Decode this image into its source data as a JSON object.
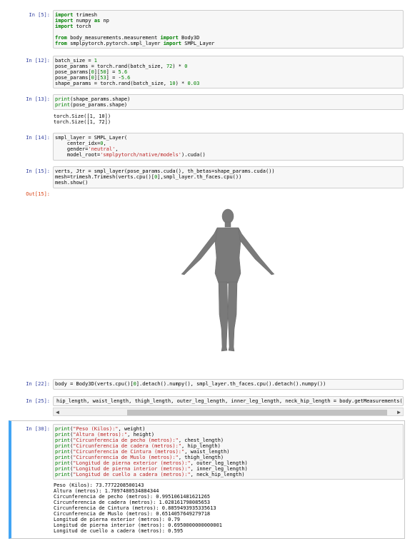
{
  "cells": {
    "c5": {
      "prompt": "In [5]:",
      "lines": [
        [
          [
            "kw",
            "import"
          ],
          [
            "t",
            " trimesh"
          ]
        ],
        [
          [
            "kw",
            "import"
          ],
          [
            "t",
            " numpy "
          ],
          [
            "kw",
            "as"
          ],
          [
            "t",
            " np"
          ]
        ],
        [
          [
            "kw",
            "import"
          ],
          [
            "t",
            " torch"
          ]
        ],
        [
          [
            "t",
            ""
          ]
        ],
        [
          [
            "kw",
            "from"
          ],
          [
            "t",
            " body_measurements.measurement "
          ],
          [
            "kw",
            "import"
          ],
          [
            "t",
            " Body3D"
          ]
        ],
        [
          [
            "kw",
            "from"
          ],
          [
            "t",
            " smplpytorch.pytorch.smpl_layer "
          ],
          [
            "kw",
            "import"
          ],
          [
            "t",
            " SMPL_Layer"
          ]
        ]
      ]
    },
    "c12": {
      "prompt": "In [12]:",
      "lines": [
        [
          [
            "t",
            "batch_size = "
          ],
          [
            "num",
            "1"
          ]
        ],
        [
          [
            "t",
            "pose_params = torch.rand(batch_size, "
          ],
          [
            "num",
            "72"
          ],
          [
            "t",
            ") * "
          ],
          [
            "num",
            "0"
          ]
        ],
        [
          [
            "t",
            "pose_params["
          ],
          [
            "num",
            "0"
          ],
          [
            "t",
            "]["
          ],
          [
            "num",
            "50"
          ],
          [
            "t",
            "] = "
          ],
          [
            "num",
            "5.6"
          ]
        ],
        [
          [
            "t",
            "pose_params["
          ],
          [
            "num",
            "0"
          ],
          [
            "t",
            "]["
          ],
          [
            "num",
            "53"
          ],
          [
            "t",
            "] = -"
          ],
          [
            "num",
            "5.6"
          ]
        ],
        [
          [
            "t",
            "shape_params = torch.rand(batch_size, "
          ],
          [
            "num",
            "10"
          ],
          [
            "t",
            ") * "
          ],
          [
            "num",
            "0.03"
          ]
        ]
      ]
    },
    "c13": {
      "prompt": "In [13]:",
      "lines": [
        [
          [
            "bi",
            "print"
          ],
          [
            "t",
            "(shape_params.shape)"
          ]
        ],
        [
          [
            "bi",
            "print"
          ],
          [
            "t",
            "(pose_params.shape)"
          ]
        ]
      ],
      "output": "torch.Size([1, 10])\ntorch.Size([1, 72])"
    },
    "c14": {
      "prompt": "In [14]:",
      "lines": [
        [
          [
            "t",
            "smpl_layer = SMPL_Layer("
          ]
        ],
        [
          [
            "t",
            "    center_idx="
          ],
          [
            "num",
            "0"
          ],
          [
            "t",
            ","
          ]
        ],
        [
          [
            "t",
            "    gender="
          ],
          [
            "str",
            "'neutral'"
          ],
          [
            "t",
            ","
          ]
        ],
        [
          [
            "t",
            "    model_root="
          ],
          [
            "str",
            "'smplpytorch/native/models'"
          ],
          [
            "t",
            ").cuda()"
          ]
        ]
      ]
    },
    "c15": {
      "prompt": "In [15]:",
      "out_prompt": "Out[15]:",
      "lines": [
        [
          [
            "t",
            "verts, Jtr = smpl_layer(pose_params.cuda(), th_betas=shape_params.cuda())"
          ]
        ],
        [
          [
            "t",
            "mesh=trimesh.Trimesh(verts.cpu()["
          ],
          [
            "num",
            "0"
          ],
          [
            "t",
            "],smpl_layer.th_faces.cpu())"
          ]
        ],
        [
          [
            "t",
            "mesh.show()"
          ]
        ]
      ]
    },
    "c22": {
      "prompt": "In [22]:",
      "lines": [
        [
          [
            "t",
            "body = Body3D(verts.cpu()["
          ],
          [
            "num",
            "0"
          ],
          [
            "t",
            "].detach().numpy(), smpl_layer.th_faces.cpu().detach().numpy())"
          ]
        ]
      ]
    },
    "c25": {
      "prompt": "In [25]:",
      "lines": [
        [
          [
            "t",
            "hip_length, waist_length, thigh_length, outer_leg_length, inner_leg_length, neck_hip_length = body.getMeasurements("
          ]
        ]
      ]
    },
    "c30": {
      "prompt": "In [30]:",
      "lines": [
        [
          [
            "bi",
            "print"
          ],
          [
            "t",
            "("
          ],
          [
            "str",
            "\"Peso (Kilos):\""
          ],
          [
            "t",
            ", weight)"
          ]
        ],
        [
          [
            "bi",
            "print"
          ],
          [
            "t",
            "("
          ],
          [
            "str",
            "\"Altura (metros):\""
          ],
          [
            "t",
            ", height)"
          ]
        ],
        [
          [
            "bi",
            "print"
          ],
          [
            "t",
            "("
          ],
          [
            "str",
            "\"Circunferencia de pecho (metros):\""
          ],
          [
            "t",
            ", chest_length)"
          ]
        ],
        [
          [
            "bi",
            "print"
          ],
          [
            "t",
            "("
          ],
          [
            "str",
            "\"Circunferencia de cadera (metros):\""
          ],
          [
            "t",
            ", hip_length)"
          ]
        ],
        [
          [
            "bi",
            "print"
          ],
          [
            "t",
            "("
          ],
          [
            "str",
            "\"Circunferencia de Cintura (metros):\""
          ],
          [
            "t",
            ", waist_length)"
          ]
        ],
        [
          [
            "bi",
            "print"
          ],
          [
            "t",
            "("
          ],
          [
            "str",
            "\"Circunferencia de Muslo (metros):\""
          ],
          [
            "t",
            ", thigh_length)"
          ]
        ],
        [
          [
            "bi",
            "print"
          ],
          [
            "t",
            "("
          ],
          [
            "str",
            "\"Longitud de pierna exterior (metros):\""
          ],
          [
            "t",
            ", outer_leg_length)"
          ]
        ],
        [
          [
            "bi",
            "print"
          ],
          [
            "t",
            "("
          ],
          [
            "str",
            "\"Longitud de pierna interior (metros):\""
          ],
          [
            "t",
            ", inner_leg_length)"
          ]
        ],
        [
          [
            "bi",
            "print"
          ],
          [
            "t",
            "("
          ],
          [
            "str",
            "\"Longitud de cuello a cadera (metros):\""
          ],
          [
            "t",
            ", neck_hip_length)"
          ]
        ]
      ],
      "output": "Peso (Kilos): 73.7772208500143\nAltura (metros): 1.7097480534884344\nCircunferencia de pecho (metros): 0.9951061481621265\nCircunferencia de cadera (metros): 1.028161798085653\nCircunferencia de Cintura (metros): 0.8859493935335613\nCircunferencia de Muslo (metros): 0.6514057649279718\nLongitud de pierna exterior (metros): 0.79\nLongitud de pierna interior (metros): 0.6950000000000001\nLongitud de cuello a cadera (metros): 0.595"
    }
  },
  "scrollbar": {
    "left_arrow": "◀",
    "right_arrow": "▶"
  },
  "colors": {
    "prompt_in": "#303f9f",
    "prompt_out": "#d84315",
    "keyword": "#008000",
    "string": "#ba2121",
    "selected_bar": "#42a5f5",
    "figure": "#7a7a7a"
  },
  "figure_icon": "3d-body-mesh"
}
